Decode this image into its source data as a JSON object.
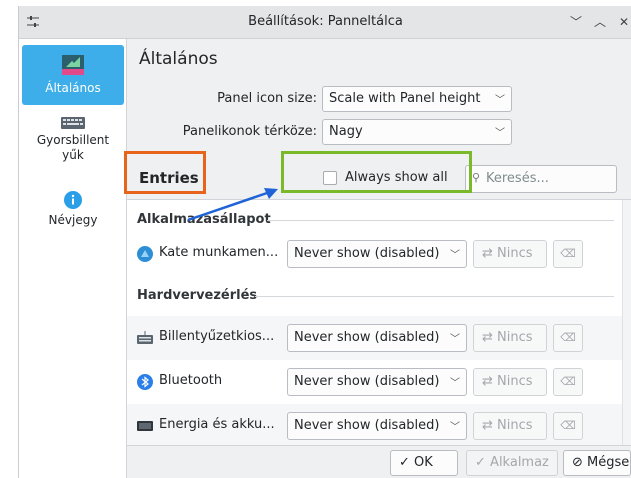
{
  "window": {
    "title": "Beállítások: Panneltálca",
    "controls": [
      "﹀",
      "︿",
      "✕"
    ]
  },
  "sidebar": {
    "items": [
      {
        "label": "Általános",
        "icon": "panel-settings-icon",
        "active": true
      },
      {
        "label": "Gyorsbillentyűk",
        "label_line1": "Gyorsbillent",
        "label_line2": "yűk",
        "icon": "keyboard-icon",
        "active": false
      },
      {
        "label": "Névjegy",
        "icon": "info-icon",
        "active": false
      }
    ]
  },
  "general": {
    "title": "Általános",
    "panel_icon_size_label": "Panel icon size:",
    "panel_icon_size_value": "Scale with Panel height",
    "spacing_label": "Panelikonok térköze:",
    "spacing_value": "Nagy"
  },
  "entries": {
    "heading": "Entries",
    "always_show_all_label": "Always show all",
    "search_placeholder": "Keresés..."
  },
  "groups": [
    {
      "heading": "Alkalmazásállapot",
      "rows": [
        {
          "name": "Kate munkamen...",
          "icon": "kate-icon",
          "visibility": "Never show (disabled)",
          "shortcut": "Nincs"
        }
      ]
    },
    {
      "heading": "Hardvervezérlés",
      "rows": [
        {
          "name": "Billentyűzetkios...",
          "icon": "keyboard-icon",
          "visibility": "Never show (disabled)",
          "shortcut": "Nincs"
        },
        {
          "name": "Bluetooth",
          "icon": "bluetooth-icon",
          "visibility": "Never show (disabled)",
          "shortcut": "Nincs"
        },
        {
          "name": "Energia és akku...",
          "icon": "battery-icon",
          "visibility": "Never show (disabled)",
          "shortcut": "Nincs"
        }
      ]
    }
  ],
  "buttons": {
    "ok": "OK",
    "apply": "Alkalmaz",
    "cancel": "Mégse"
  },
  "colors": {
    "accent": "#3daee9",
    "annotation_orange": "#e8641b",
    "annotation_green": "#7ab929",
    "annotation_arrow": "#1f63d6"
  }
}
